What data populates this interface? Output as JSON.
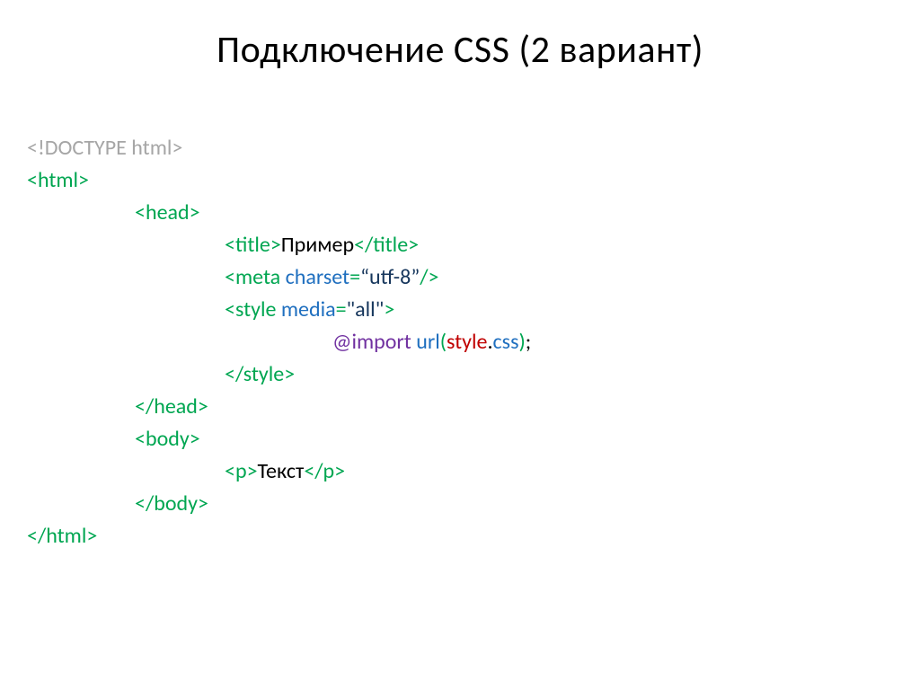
{
  "title": "Подключение CSS (2 вариант)",
  "code": {
    "doctype": "<!DOCTYPE html>",
    "html_open": "<html>",
    "head_open": "<head>",
    "title_open": "<title>",
    "title_text": "Пример",
    "title_close": "</title>",
    "meta_open": "<meta ",
    "meta_attr_name": "charset",
    "meta_attr_eq": "=",
    "meta_attr_val": "“utf-8”",
    "meta_close": "/>",
    "style_open": "<style ",
    "style_attr_name": "media",
    "style_attr_eq": "=",
    "style_attr_val": "\"all\"",
    "style_close_angle": ">",
    "import_kw": "@import ",
    "url_fn": "url",
    "paren_open": "(",
    "style_file_name": "style",
    "dot": ".",
    "style_file_ext": "css",
    "paren_close": ")",
    "semicolon": ";",
    "style_close": "</style>",
    "head_close": "</head>",
    "body_open": "<body>",
    "p_open": "<p>",
    "p_text": "Текст",
    "p_close": "</p>",
    "body_close": "</body>",
    "html_close": "</html>"
  }
}
